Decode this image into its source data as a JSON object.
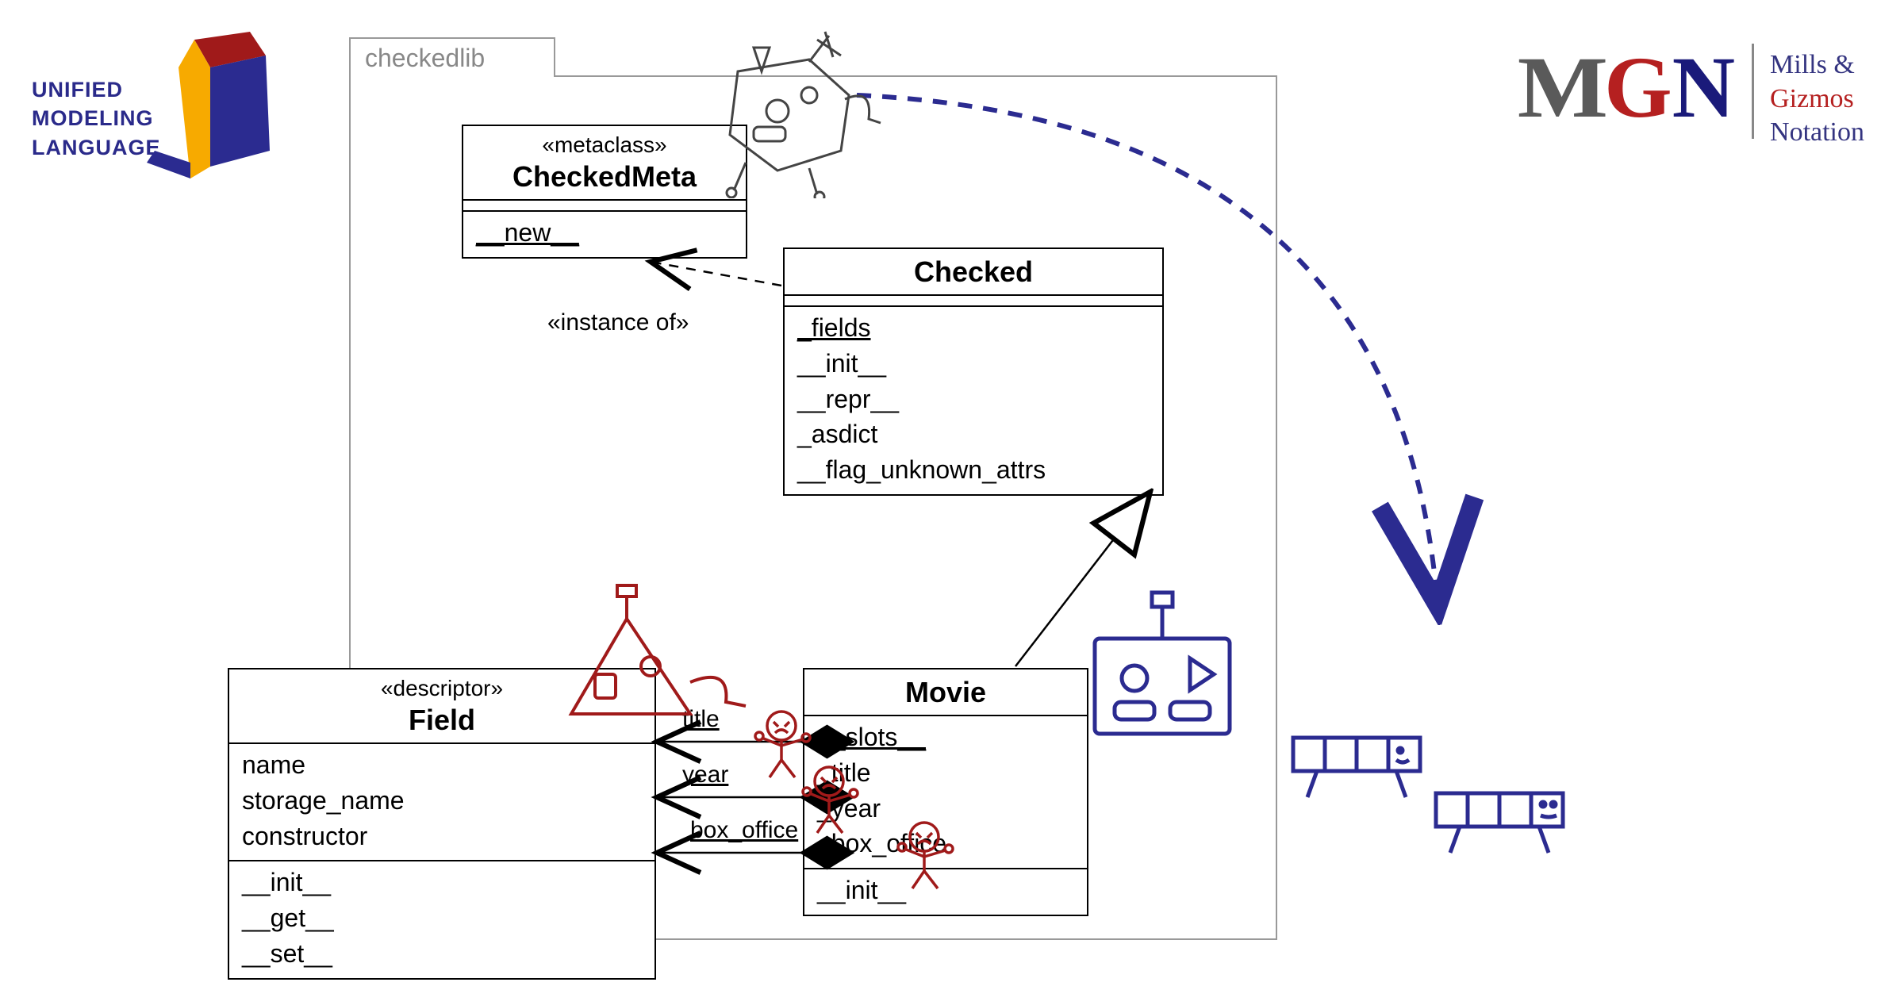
{
  "logos": {
    "uml": {
      "line1": "UNIFIED",
      "line2": "MODELING",
      "line3": "LANGUAGE"
    },
    "mgn": {
      "letters": "MGN",
      "line1": "Mills &",
      "line2": "Gizmos",
      "line3": "Notation"
    }
  },
  "package": {
    "name": "checkedlib"
  },
  "classes": {
    "checkedmeta": {
      "stereotype": "«metaclass»",
      "name": "CheckedMeta",
      "methods": [
        "__new__"
      ]
    },
    "checked": {
      "name": "Checked",
      "members": [
        "_fields",
        "__init__",
        "__repr__",
        "_asdict",
        "__flag_unknown_attrs"
      ]
    },
    "field": {
      "stereotype": "«descriptor»",
      "name": "Field",
      "attrs": [
        "name",
        "storage_name",
        "constructor"
      ],
      "methods": [
        "__init__",
        "__get__",
        "__set__"
      ]
    },
    "movie": {
      "name": "Movie",
      "members": [
        "__slots__",
        "_title",
        "_year",
        "_box_office"
      ],
      "methods": [
        "__init__"
      ]
    }
  },
  "relations": {
    "instance_of": "«instance of»",
    "assoc": {
      "title": "title",
      "year": "year",
      "box_office": "box_office"
    }
  },
  "colors": {
    "navy": "#2b2b90",
    "dark_red": "#a01a1a",
    "gold": "#f7aa00",
    "gray": "#5a5a5a"
  },
  "chart_data": {
    "type": "diagram",
    "diagram_kind": "UML class diagram with MGN annotations",
    "package": "checkedlib",
    "classes": [
      {
        "name": "CheckedMeta",
        "stereotype": "metaclass",
        "operations": [
          "__new__"
        ]
      },
      {
        "name": "Checked",
        "attributes": [
          "_fields"
        ],
        "operations": [
          "__init__",
          "__repr__",
          "_asdict",
          "__flag_unknown_attrs"
        ]
      },
      {
        "name": "Field",
        "stereotype": "descriptor",
        "attributes": [
          "name",
          "storage_name",
          "constructor"
        ],
        "operations": [
          "__init__",
          "__get__",
          "__set__"
        ]
      },
      {
        "name": "Movie",
        "attributes": [
          "__slots__",
          "_title",
          "_year",
          "_box_office"
        ],
        "operations": [
          "__init__"
        ]
      }
    ],
    "relationships": [
      {
        "from": "Checked",
        "to": "CheckedMeta",
        "type": "dependency",
        "label": "instance of"
      },
      {
        "from": "Movie",
        "to": "Checked",
        "type": "generalization"
      },
      {
        "from": "Movie",
        "to": "Field",
        "type": "composition",
        "role": "title"
      },
      {
        "from": "Movie",
        "to": "Field",
        "type": "composition",
        "role": "year"
      },
      {
        "from": "Movie",
        "to": "Field",
        "type": "composition",
        "role": "box_office"
      },
      {
        "from": "CheckedMeta",
        "to": "Movie",
        "type": "mgn-builds",
        "style": "dashed-arc"
      }
    ]
  }
}
